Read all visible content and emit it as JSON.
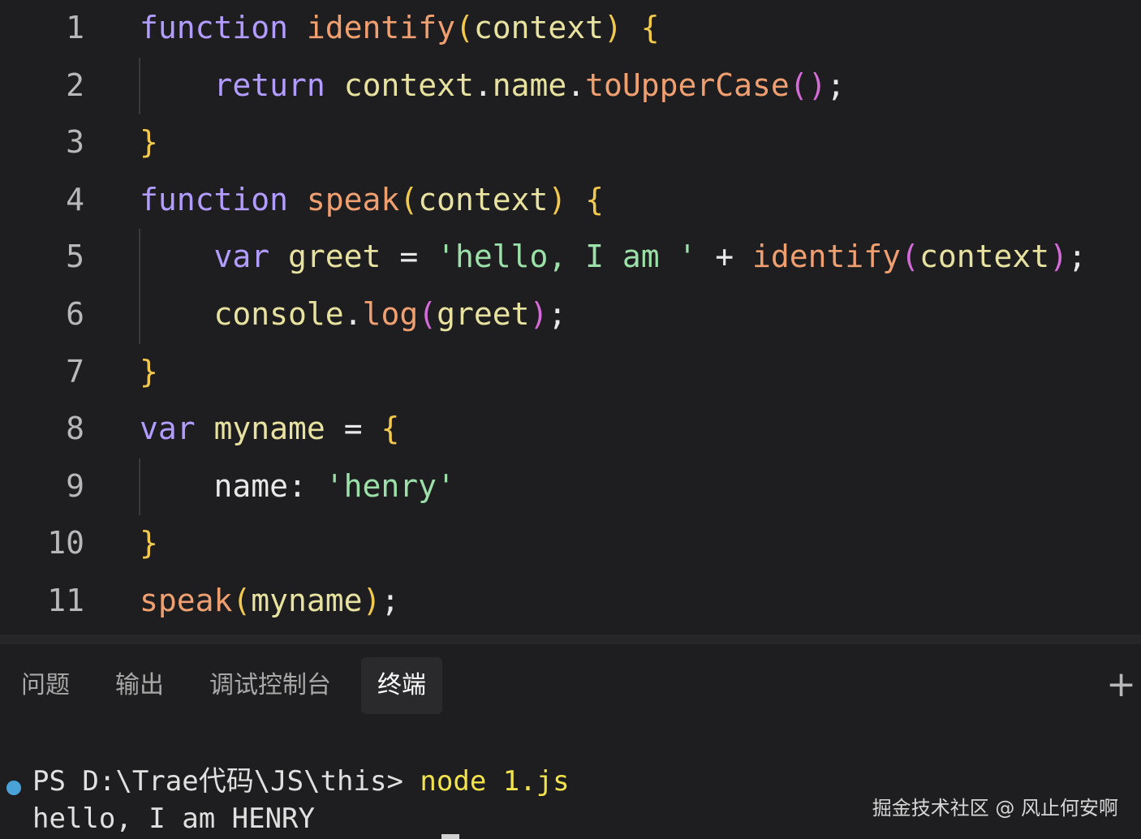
{
  "editor": {
    "line_numbers": [
      "1",
      "2",
      "3",
      "4",
      "5",
      "6",
      "7",
      "8",
      "9",
      "10",
      "11"
    ],
    "lines": [
      [
        {
          "t": "function",
          "c": "kw"
        },
        {
          "t": " ",
          "c": "op"
        },
        {
          "t": "identify",
          "c": "fn"
        },
        {
          "t": "(",
          "c": "br1"
        },
        {
          "t": "context",
          "c": "id"
        },
        {
          "t": ")",
          "c": "br1"
        },
        {
          "t": " ",
          "c": "op"
        },
        {
          "t": "{",
          "c": "br1"
        }
      ],
      [
        {
          "t": "    ",
          "c": "op"
        },
        {
          "t": "return",
          "c": "kw"
        },
        {
          "t": " ",
          "c": "op"
        },
        {
          "t": "context",
          "c": "id"
        },
        {
          "t": ".",
          "c": "op"
        },
        {
          "t": "name",
          "c": "id"
        },
        {
          "t": ".",
          "c": "op"
        },
        {
          "t": "toUpperCase",
          "c": "fn"
        },
        {
          "t": "()",
          "c": "br2"
        },
        {
          "t": ";",
          "c": "op"
        }
      ],
      [
        {
          "t": "}",
          "c": "br1"
        }
      ],
      [
        {
          "t": "function",
          "c": "kw"
        },
        {
          "t": " ",
          "c": "op"
        },
        {
          "t": "speak",
          "c": "fn"
        },
        {
          "t": "(",
          "c": "br1"
        },
        {
          "t": "context",
          "c": "id"
        },
        {
          "t": ")",
          "c": "br1"
        },
        {
          "t": " ",
          "c": "op"
        },
        {
          "t": "{",
          "c": "br1"
        }
      ],
      [
        {
          "t": "    ",
          "c": "op"
        },
        {
          "t": "var",
          "c": "kw"
        },
        {
          "t": " ",
          "c": "op"
        },
        {
          "t": "greet",
          "c": "id"
        },
        {
          "t": " = ",
          "c": "op"
        },
        {
          "t": "'hello, I am '",
          "c": "str"
        },
        {
          "t": " + ",
          "c": "op"
        },
        {
          "t": "identify",
          "c": "fn"
        },
        {
          "t": "(",
          "c": "br2"
        },
        {
          "t": "context",
          "c": "id"
        },
        {
          "t": ")",
          "c": "br2"
        },
        {
          "t": ";",
          "c": "op"
        }
      ],
      [
        {
          "t": "    ",
          "c": "op"
        },
        {
          "t": "console",
          "c": "id"
        },
        {
          "t": ".",
          "c": "op"
        },
        {
          "t": "log",
          "c": "fn"
        },
        {
          "t": "(",
          "c": "br2"
        },
        {
          "t": "greet",
          "c": "id"
        },
        {
          "t": ")",
          "c": "br2"
        },
        {
          "t": ";",
          "c": "op"
        }
      ],
      [
        {
          "t": "}",
          "c": "br1"
        }
      ],
      [
        {
          "t": "var",
          "c": "kw"
        },
        {
          "t": " ",
          "c": "op"
        },
        {
          "t": "myname",
          "c": "id"
        },
        {
          "t": " = ",
          "c": "op"
        },
        {
          "t": "{",
          "c": "br1"
        }
      ],
      [
        {
          "t": "    ",
          "c": "op"
        },
        {
          "t": "name",
          "c": "prop"
        },
        {
          "t": ": ",
          "c": "op"
        },
        {
          "t": "'henry'",
          "c": "str"
        }
      ],
      [
        {
          "t": "}",
          "c": "br1"
        }
      ],
      [
        {
          "t": "speak",
          "c": "fn"
        },
        {
          "t": "(",
          "c": "br1"
        },
        {
          "t": "myname",
          "c": "id"
        },
        {
          "t": ")",
          "c": "br1"
        },
        {
          "t": ";",
          "c": "op"
        }
      ]
    ]
  },
  "panel": {
    "tabs": [
      "问题",
      "输出",
      "调试控制台",
      "终端"
    ],
    "active_tab": "终端",
    "add_icon": "plus-icon"
  },
  "terminal": {
    "prompt": "PS D:\\Trae代码\\JS\\this> ",
    "command": "node 1.js",
    "output": "hello, I am HENRY"
  },
  "watermark": "掘金技术社区 @ 风止何安啊"
}
